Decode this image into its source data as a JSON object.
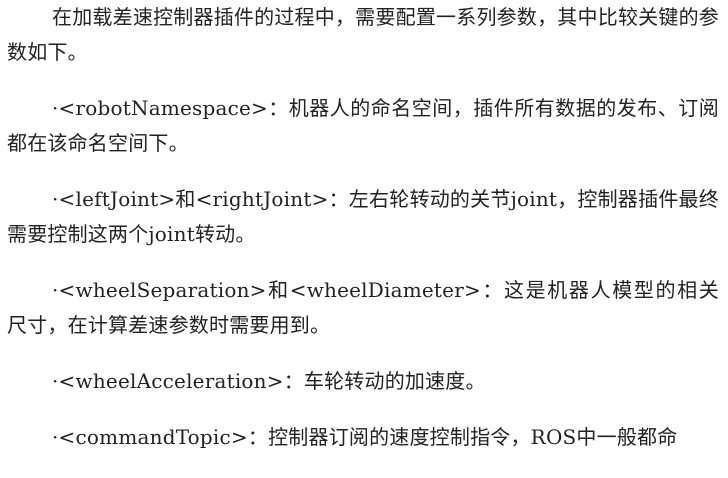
{
  "paragraphs": [
    "在加载差速控制器插件的过程中，需要配置一系列参数，其中比较关键的参数如下。",
    "·<robotNamespace>：机器人的命名空间，插件所有数据的发布、订阅都在该命名空间下。",
    "·<leftJoint>和<rightJoint>：左右轮转动的关节joint，控制器插件最终需要控制这两个joint转动。",
    "·<wheelSeparation>和<wheelDiameter>：这是机器人模型的相关尺寸，在计算差速参数时需要用到。",
    "·<wheelAcceleration>：车轮转动的加速度。",
    "·<commandTopic>：控制器订阅的速度控制指令，ROS中一般都命"
  ]
}
